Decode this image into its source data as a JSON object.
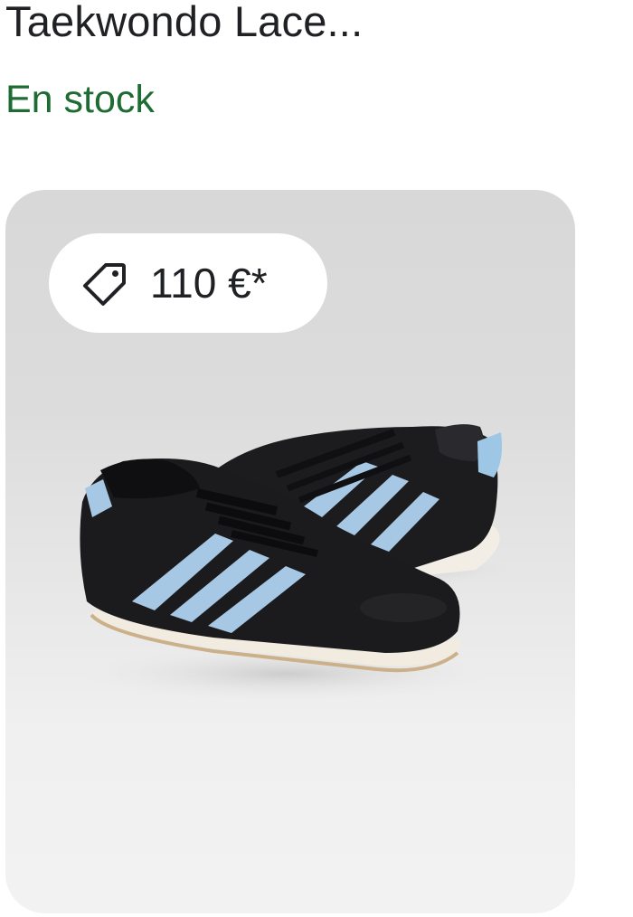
{
  "product": {
    "title": "Taekwondo Lace...",
    "stock_status": "En stock",
    "price": "110 €*",
    "image_alt": "",
    "colors": {
      "stock": "#1e6b34",
      "title": "#202124",
      "card_background": "#dcdcdc",
      "chip_background": "#ffffff"
    },
    "icons": {
      "price": "tag-icon"
    }
  }
}
